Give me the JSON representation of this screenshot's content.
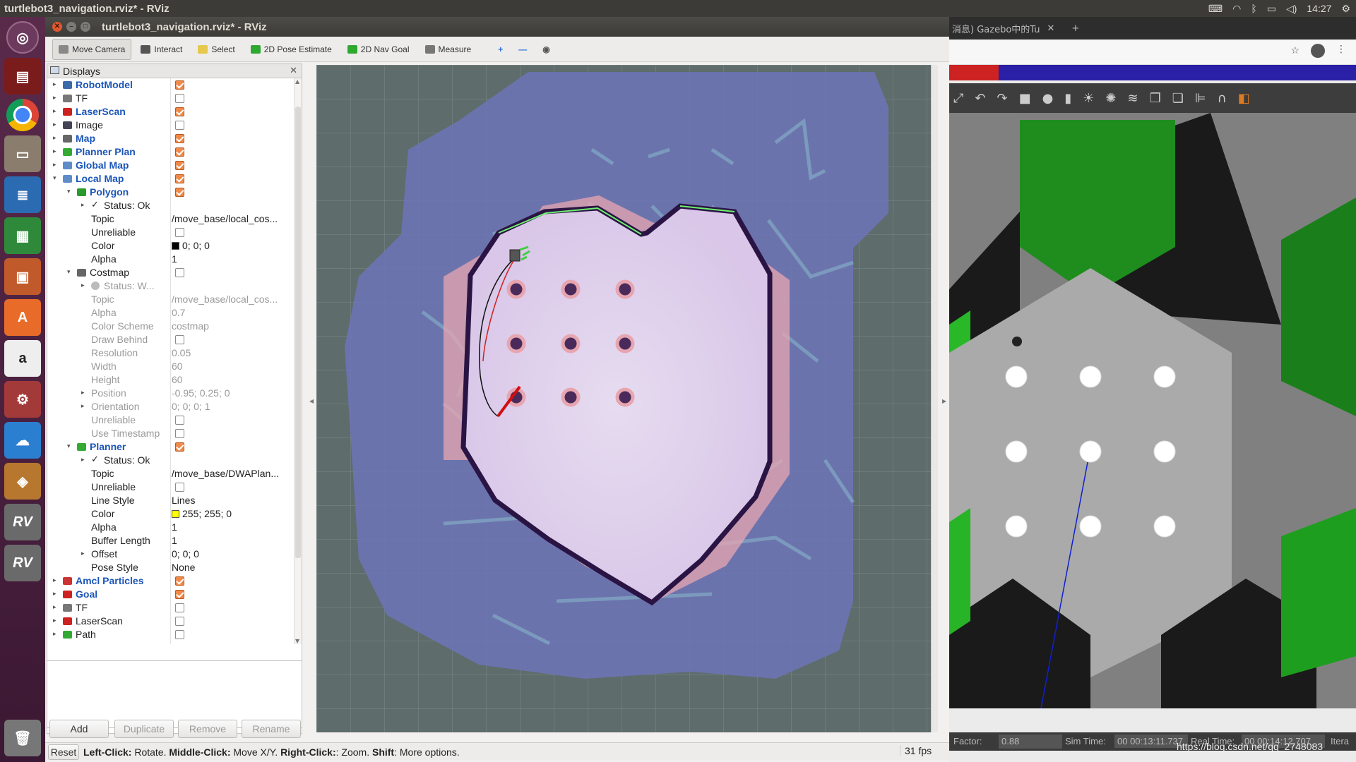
{
  "topbar": {
    "title": "turtlebot3_navigation.rviz* - RViz",
    "time": "14:27"
  },
  "rviz": {
    "window_title": "turtlebot3_navigation.rviz* - RViz",
    "toolbar": [
      {
        "label": "Move Camera",
        "icon": "camera-move-icon",
        "color": "#888888"
      },
      {
        "label": "Interact",
        "icon": "hand-icon",
        "color": "#555555"
      },
      {
        "label": "Select",
        "icon": "select-box-icon",
        "color": "#e6c84a"
      },
      {
        "label": "2D Pose Estimate",
        "icon": "arrow-green-icon",
        "color": "#2fa82f"
      },
      {
        "label": "2D Nav Goal",
        "icon": "arrow-green-icon",
        "color": "#2fa82f"
      },
      {
        "label": "Measure",
        "icon": "ruler-icon",
        "color": "#777777"
      }
    ],
    "displays_title": "Displays",
    "tree": [
      {
        "indent": 0,
        "arrow": "▸",
        "name": "RobotModel",
        "hl": true,
        "check": true,
        "icon": "robot-model-icon"
      },
      {
        "indent": 0,
        "arrow": "▸",
        "name": "TF",
        "check": false,
        "icon": "tf-icon"
      },
      {
        "indent": 0,
        "arrow": "▸",
        "name": "LaserScan",
        "hl": true,
        "check": true,
        "icon": "laser-scan-icon"
      },
      {
        "indent": 0,
        "arrow": "▸",
        "name": "Image",
        "check": false,
        "icon": "image-icon"
      },
      {
        "indent": 0,
        "arrow": "▸",
        "name": "Map",
        "hl": true,
        "check": true,
        "icon": "map-icon"
      },
      {
        "indent": 0,
        "arrow": "▸",
        "name": "Planner Plan",
        "hl": true,
        "check": true,
        "icon": "path-icon"
      },
      {
        "indent": 0,
        "arrow": "▸",
        "name": "Global Map",
        "hl": true,
        "check": true,
        "icon": "folder-icon"
      },
      {
        "indent": 0,
        "arrow": "▾",
        "name": "Local Map",
        "hl": true,
        "check": true,
        "icon": "folder-icon"
      },
      {
        "indent": 1,
        "arrow": "▾",
        "name": "Polygon",
        "hl": true,
        "check": true,
        "icon": "polygon-icon"
      },
      {
        "indent": 2,
        "arrow": "▸",
        "name": "Status: Ok",
        "icon": "status-ok-icon"
      },
      {
        "indent": 2,
        "name": "Topic",
        "val": "/move_base/local_cos..."
      },
      {
        "indent": 2,
        "name": "Unreliable",
        "check": false
      },
      {
        "indent": 2,
        "name": "Color",
        "val": "0; 0; 0",
        "swatch": "#000000"
      },
      {
        "indent": 2,
        "name": "Alpha",
        "val": "1"
      },
      {
        "indent": 1,
        "arrow": "▾",
        "name": "Costmap",
        "check": false,
        "icon": "map-icon"
      },
      {
        "indent": 2,
        "arrow": "▸",
        "name": "Status: W...",
        "grey": true,
        "icon": "status-warn-icon"
      },
      {
        "indent": 2,
        "name": "Topic",
        "val": "/move_base/local_cos...",
        "grey": true
      },
      {
        "indent": 2,
        "name": "Alpha",
        "val": "0.7",
        "grey": true
      },
      {
        "indent": 2,
        "name": "Color Scheme",
        "val": "costmap",
        "grey": true
      },
      {
        "indent": 2,
        "name": "Draw Behind",
        "check": false,
        "grey": true
      },
      {
        "indent": 2,
        "name": "Resolution",
        "val": "0.05",
        "grey": true
      },
      {
        "indent": 2,
        "name": "Width",
        "val": "60",
        "grey": true
      },
      {
        "indent": 2,
        "name": "Height",
        "val": "60",
        "grey": true
      },
      {
        "indent": 2,
        "arrow": "▸",
        "name": "Position",
        "val": "-0.95; 0.25; 0",
        "grey": true
      },
      {
        "indent": 2,
        "arrow": "▸",
        "name": "Orientation",
        "val": "0; 0; 0; 1",
        "grey": true
      },
      {
        "indent": 2,
        "name": "Unreliable",
        "check": false,
        "grey": true
      },
      {
        "indent": 2,
        "name": "Use Timestamp",
        "check": false,
        "grey": true
      },
      {
        "indent": 1,
        "arrow": "▾",
        "name": "Planner",
        "hl": true,
        "check": true,
        "icon": "path-icon"
      },
      {
        "indent": 2,
        "arrow": "▸",
        "name": "Status: Ok",
        "icon": "status-ok-icon"
      },
      {
        "indent": 2,
        "name": "Topic",
        "val": "/move_base/DWAPlan..."
      },
      {
        "indent": 2,
        "name": "Unreliable",
        "check": false
      },
      {
        "indent": 2,
        "name": "Line Style",
        "val": "Lines"
      },
      {
        "indent": 2,
        "name": "Color",
        "val": "255; 255; 0",
        "swatch": "#ffff00"
      },
      {
        "indent": 2,
        "name": "Alpha",
        "val": "1"
      },
      {
        "indent": 2,
        "name": "Buffer Length",
        "val": "1"
      },
      {
        "indent": 2,
        "arrow": "▸",
        "name": "Offset",
        "val": "0; 0; 0"
      },
      {
        "indent": 2,
        "name": "Pose Style",
        "val": "None"
      },
      {
        "indent": 0,
        "arrow": "▸",
        "name": "Amcl Particles",
        "hl": true,
        "check": true,
        "icon": "particles-icon"
      },
      {
        "indent": 0,
        "arrow": "▸",
        "name": "Goal",
        "hl": true,
        "check": true,
        "icon": "goal-icon"
      },
      {
        "indent": 0,
        "arrow": "▸",
        "name": "TF",
        "check": false,
        "icon": "tf-icon"
      },
      {
        "indent": 0,
        "arrow": "▸",
        "name": "LaserScan",
        "check": false,
        "icon": "laser-scan-icon"
      },
      {
        "indent": 0,
        "arrow": "▸",
        "name": "Path",
        "check": false,
        "icon": "path-icon"
      }
    ],
    "buttons": {
      "add": "Add",
      "duplicate": "Duplicate",
      "remove": "Remove",
      "rename": "Rename"
    },
    "status": {
      "reset": "Reset",
      "leftclick_k": "Left-Click:",
      "leftclick_v": " Rotate. ",
      "middle_k": "Middle-Click:",
      "middle_v": " Move X/Y. ",
      "right_k": "Right-Click:",
      "right_v": ": Zoom. ",
      "shift_k": "Shift",
      "shift_v": ": More options.",
      "fps": "31 fps"
    }
  },
  "gazebo": {
    "tab_title": "消息) Gazebo中的Tu",
    "factor_label": "Factor:",
    "factor_value": "0.88",
    "sim_time_label": "Sim Time:",
    "sim_time_value": "00 00:13:11.737",
    "real_time_label": "Real Time:",
    "real_time_value": "00 00:14:12.707",
    "iter_label": "Itera",
    "watermark": "https://blog.csdn.net/qq_2748083"
  }
}
